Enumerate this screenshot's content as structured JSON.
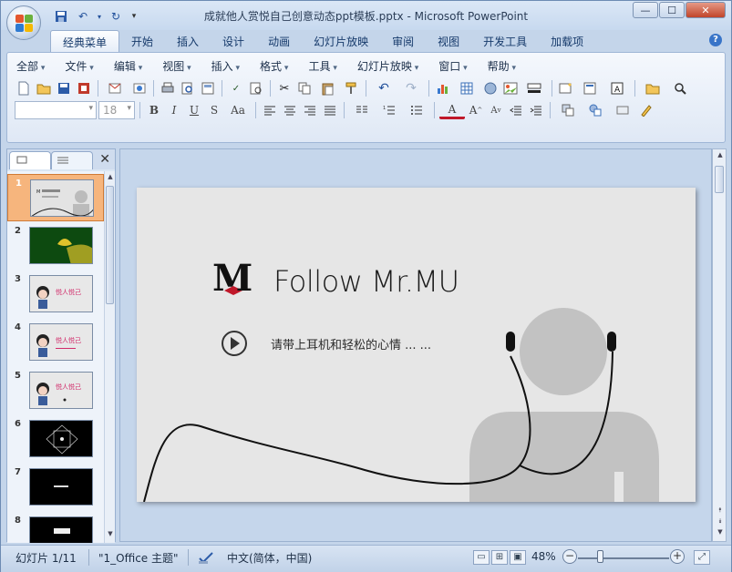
{
  "window": {
    "title": "成就他人赏悦自己创意动态ppt模板.pptx - Microsoft PowerPoint",
    "buttons": [
      "—",
      "☐",
      "✕"
    ]
  },
  "ribbon": {
    "tabs": [
      "经典菜单",
      "开始",
      "插入",
      "设计",
      "动画",
      "幻灯片放映",
      "审阅",
      "视图",
      "开发工具",
      "加载项"
    ],
    "menus": [
      "全部",
      "文件",
      "编辑",
      "视图",
      "插入",
      "格式",
      "工具",
      "幻灯片放映",
      "窗口",
      "帮助"
    ],
    "font_size_placeholder": "18"
  },
  "slides_panel": {
    "close_label": "✕",
    "slide_numbers": [
      "1",
      "2",
      "3",
      "4",
      "5",
      "6",
      "7",
      "8"
    ]
  },
  "slide": {
    "logo_text": "M",
    "headline": "Follow Mr.MU",
    "subtitle": "请带上耳机和轻松的心情 ... ..."
  },
  "statusbar": {
    "slide_info": "幻灯片 1/11",
    "theme": "\"1_Office 主题\"",
    "language": "中文(简体，中国)",
    "zoom": "48%"
  },
  "colors": {
    "accent_red": "#c0182a",
    "selected_thumb": "#f6b57d"
  }
}
